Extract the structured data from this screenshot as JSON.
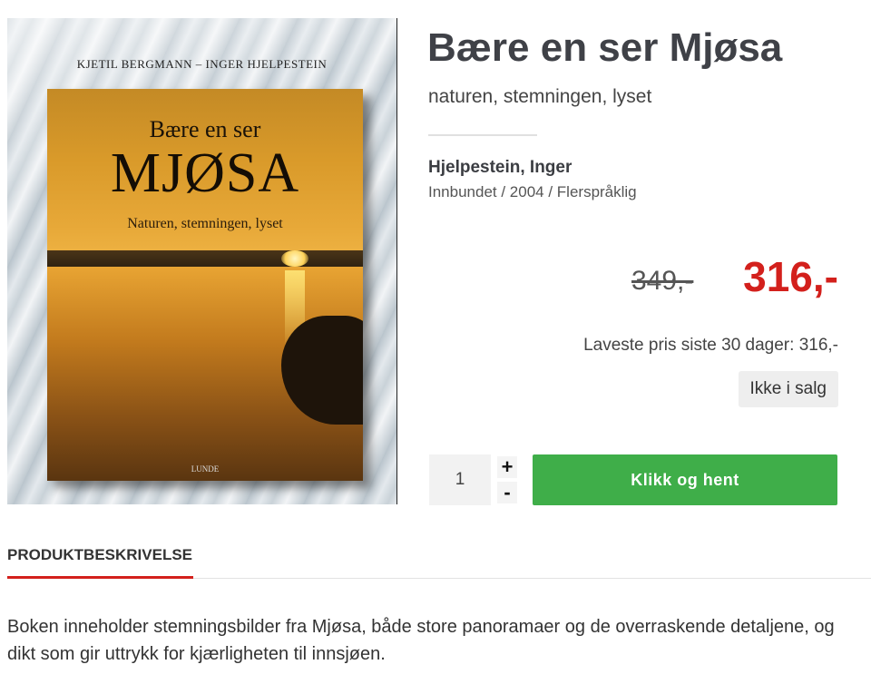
{
  "cover": {
    "authors": "KJETIL BERGMANN – INGER HJELPESTEIN",
    "title_line1": "Bære en ser",
    "title_line2": "MJØSA",
    "subtitle": "Naturen, stemningen, lyset",
    "publisher": "LUNDE"
  },
  "product": {
    "title": "Bære en ser Mjøsa",
    "subtitle": "naturen, stemningen, lyset",
    "author": "Hjelpestein, Inger",
    "format": "Innbundet / 2004 / Flerspråklig"
  },
  "pricing": {
    "old_price": "349,-",
    "new_price": "316,-",
    "lowest_30_days": "Laveste pris siste 30 dager: 316,-",
    "availability": "Ikke i salg"
  },
  "cart": {
    "quantity": "1",
    "plus": "+",
    "minus": "-",
    "button_label": "Klikk og hent"
  },
  "tabs": {
    "description_tab": "PRODUKTBESKRIVELSE"
  },
  "description": {
    "text": "Boken inneholder stemningsbilder fra Mjøsa, både store panoramaer og de overraskende detaljene, og dikt som gir uttrykk for kjærligheten til innsjøen."
  },
  "colors": {
    "accent_red": "#d3201c",
    "button_green": "#3fae49"
  }
}
